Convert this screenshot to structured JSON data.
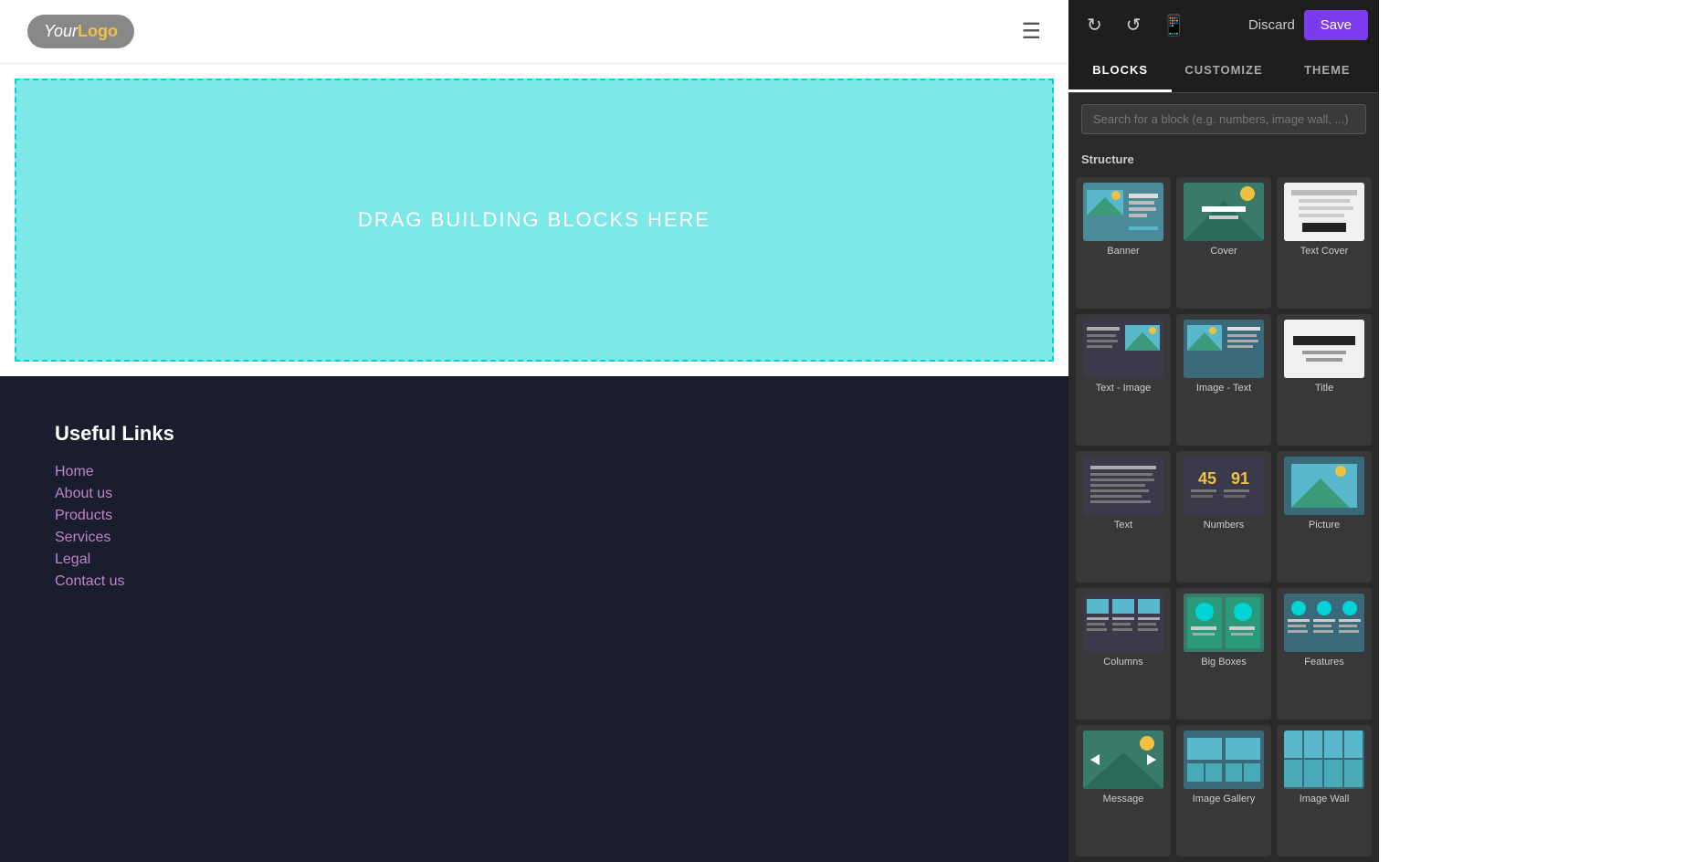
{
  "header": {
    "logo_your": "Your",
    "logo_logo": "Logo"
  },
  "drop_zone": {
    "text": "DRAG BUILDING BLOCKS HERE"
  },
  "footer": {
    "heading": "Useful Links",
    "links": [
      {
        "label": "Home"
      },
      {
        "label": "About us"
      },
      {
        "label": "Products"
      },
      {
        "label": "Services"
      },
      {
        "label": "Legal"
      },
      {
        "label": "Contact us"
      }
    ]
  },
  "right_panel": {
    "top_bar": {
      "discard_label": "Discard",
      "save_label": "Save"
    },
    "tabs": [
      {
        "id": "blocks",
        "label": "BLOCKS",
        "active": true
      },
      {
        "id": "customize",
        "label": "CUSTOMIZE",
        "active": false
      },
      {
        "id": "theme",
        "label": "THEME",
        "active": false
      }
    ],
    "search_placeholder": "Search for a block (e.g. numbers, image wall, ...)",
    "section_label": "Structure",
    "blocks": [
      {
        "id": "banner",
        "label": "Banner",
        "thumb_class": "thumb-banner"
      },
      {
        "id": "cover",
        "label": "Cover",
        "thumb_class": "thumb-cover"
      },
      {
        "id": "text-cover",
        "label": "Text Cover",
        "thumb_class": "thumb-text-cover"
      },
      {
        "id": "text-image",
        "label": "Text - Image",
        "thumb_class": "thumb-text-image"
      },
      {
        "id": "image-text",
        "label": "Image - Text",
        "thumb_class": "thumb-image-text"
      },
      {
        "id": "title",
        "label": "Title",
        "thumb_class": "thumb-title"
      },
      {
        "id": "text",
        "label": "Text",
        "thumb_class": "thumb-text"
      },
      {
        "id": "numbers",
        "label": "Numbers",
        "thumb_class": "thumb-numbers"
      },
      {
        "id": "picture",
        "label": "Picture",
        "thumb_class": "thumb-picture"
      },
      {
        "id": "columns",
        "label": "Columns",
        "thumb_class": "thumb-columns"
      },
      {
        "id": "big-boxes",
        "label": "Big Boxes",
        "thumb_class": "thumb-bigboxes"
      },
      {
        "id": "features",
        "label": "Features",
        "thumb_class": "thumb-features"
      },
      {
        "id": "message",
        "label": "Message",
        "thumb_class": "thumb-message"
      },
      {
        "id": "image-gallery",
        "label": "Image Gallery",
        "thumb_class": "thumb-image-gallery"
      },
      {
        "id": "image-wall",
        "label": "Image Wall",
        "thumb_class": "thumb-image-wall"
      }
    ]
  }
}
